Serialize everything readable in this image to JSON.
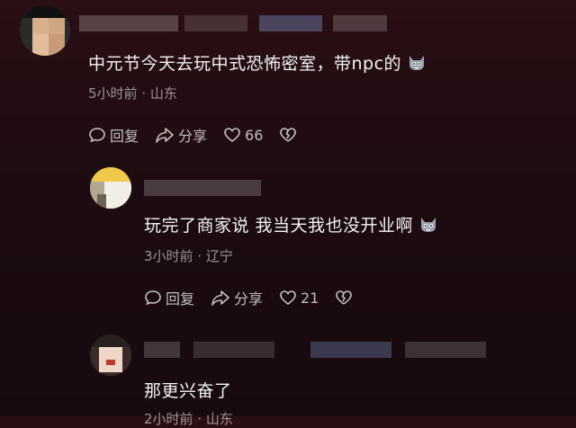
{
  "comments": [
    {
      "text": "中元节今天去玩中式恐怖密室，带npc的",
      "emoji": "cat-face-icon",
      "time": "5小时前",
      "location": "山东",
      "reply_label": "回复",
      "share_label": "分享",
      "likes": "66"
    },
    {
      "text": "玩完了商家说 我当天我也没开业啊",
      "emoji": "cat-face-icon",
      "time": "3小时前",
      "location": "辽宁",
      "reply_label": "回复",
      "share_label": "分享",
      "likes": "21"
    },
    {
      "text": "那更兴奋了",
      "time": "2小时前",
      "location": "山东"
    }
  ],
  "separator": " · ",
  "colors": {
    "background": "#1c0b10",
    "text": "#f3f3f3",
    "muted": "#8c8184"
  }
}
